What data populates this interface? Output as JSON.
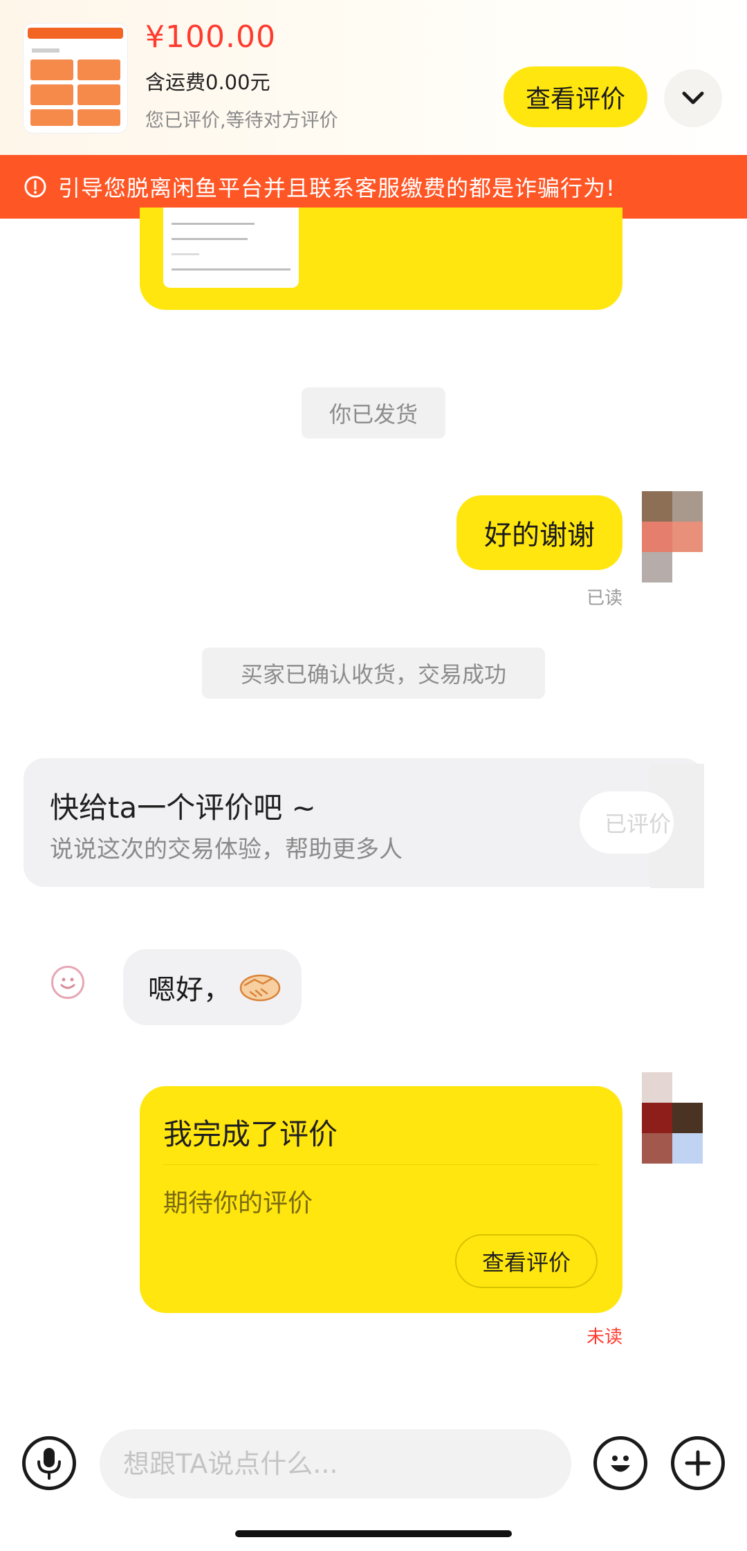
{
  "product": {
    "price": "¥100.00",
    "shipping": "含运费0.00元",
    "status": "您已评价,等待对方评价",
    "view_review_label": "查看评价",
    "expand_icon": "chevron-down-icon"
  },
  "warning": {
    "text": "引导您脱离闲鱼平台并且联系客服缴费的都是诈骗行为!",
    "icon": "alert-circle-icon"
  },
  "messages": {
    "system_shipped": "你已发货",
    "outgoing_thanks": "好的谢谢",
    "read_status": "已读",
    "system_confirmed": "买家已确认收货，交易成功",
    "review_prompt": {
      "title": "快给ta一个评价吧 ~",
      "subtitle": "说说这次的交易体验，帮助更多人",
      "action": "已评价"
    },
    "incoming_reply": "嗯好，",
    "done_card": {
      "title": "我完成了评价",
      "subtitle": "期待你的评价",
      "button": "查看评价"
    },
    "unread_status": "未读"
  },
  "input_bar": {
    "placeholder": "想跟TA说点什么...",
    "voice_icon": "microphone-icon",
    "emoji_icon": "emoji-icon",
    "add_icon": "plus-icon"
  },
  "colors": {
    "accent_yellow": "#ffe60f",
    "warning_orange": "#ff5626",
    "price_red": "#ff3b2f"
  }
}
